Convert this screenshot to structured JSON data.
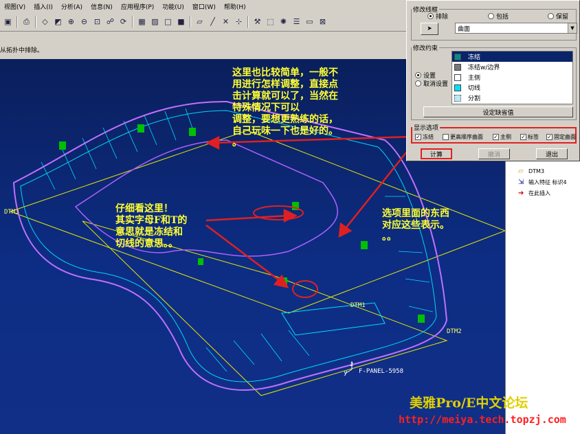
{
  "menu": [
    "视图(V)",
    "插入(I)",
    "分析(A)",
    "信息(N)",
    "应用程序(P)",
    "功能(U)",
    "窗口(W)",
    "帮助(H)"
  ],
  "toolbar_icons": [
    "save-icon",
    "separator",
    "print-icon",
    "separator",
    "repaint-icon",
    "orient-icon",
    "zoom-in-icon",
    "zoom-out-icon",
    "fit-icon",
    "view-manager-icon",
    "spin-icon",
    "separator",
    "wireframe-icon",
    "hidden-line-icon",
    "no-hidden-icon",
    "shading-icon",
    "separator",
    "datum-plane-icon",
    "datum-axis-icon",
    "datum-point-icon",
    "csys-icon",
    "separator",
    "tool-icon",
    "select-icon",
    "help-icon",
    "layers-icon",
    "window-icon",
    "close-icon"
  ],
  "message": "从拓扑中排除。",
  "dialog": {
    "modify_lines": {
      "legend": "修改线框",
      "options": [
        "排除",
        "包括",
        "保留"
      ],
      "selected": 0,
      "select_value": "曲面"
    },
    "modify_constraints": {
      "legend": "修改约束",
      "radios": [
        "设置",
        "取消设置"
      ],
      "selected": 0,
      "items": [
        {
          "label": "冻结",
          "color": "#0b8a8a"
        },
        {
          "label": "冻结w/边界",
          "color": "#777777"
        },
        {
          "label": "主侧",
          "color": "#ffffff"
        },
        {
          "label": "切线",
          "color": "#00e0ff"
        },
        {
          "label": "分割",
          "color": "#bfe6f5"
        }
      ],
      "selected_item": 0,
      "default_button": "设定缺省值"
    },
    "display_options": {
      "legend": "显示选项",
      "checks": [
        {
          "label": "冻结",
          "checked": true
        },
        {
          "label": "更高顺序曲面",
          "checked": false
        },
        {
          "label": "主侧",
          "checked": true
        },
        {
          "label": "标签",
          "checked": true
        },
        {
          "label": "固定曲面",
          "checked": true
        }
      ]
    },
    "buttons": {
      "compute": "计算",
      "undo": "撤消",
      "exit": "退出"
    }
  },
  "tree": [
    {
      "icon": "datum-plane-icon",
      "label": "DTM3"
    },
    {
      "icon": "import-feature-icon",
      "label": "输入特征 标识4"
    },
    {
      "icon": "insert-here-icon",
      "label": "在此插入"
    }
  ],
  "annotations": {
    "top": "这里也比较简单，一般不\n用进行怎样调整，直接点\n击计算就可以了，当然在\n特殊情况下可以\n调整，要想更熟练的话，\n自己玩味一下也是好的。\n。",
    "left": "仔细看这里！\n其实字母F和T的\n意思就是冻结和\n切线的意思。。",
    "right": "选项里面的东西\n对应这些表示。\n。。"
  },
  "datums": {
    "dtm3": "DTM3",
    "dtm1": "DTM1",
    "dtm2": "DTM2",
    "csys_z": "z",
    "csys_y": "y",
    "csys_label": "F-PANEL-5958"
  },
  "watermark": {
    "forum": "美雅Pro/E中文论坛",
    "url": "http://meiya.tech.topzj.com"
  }
}
